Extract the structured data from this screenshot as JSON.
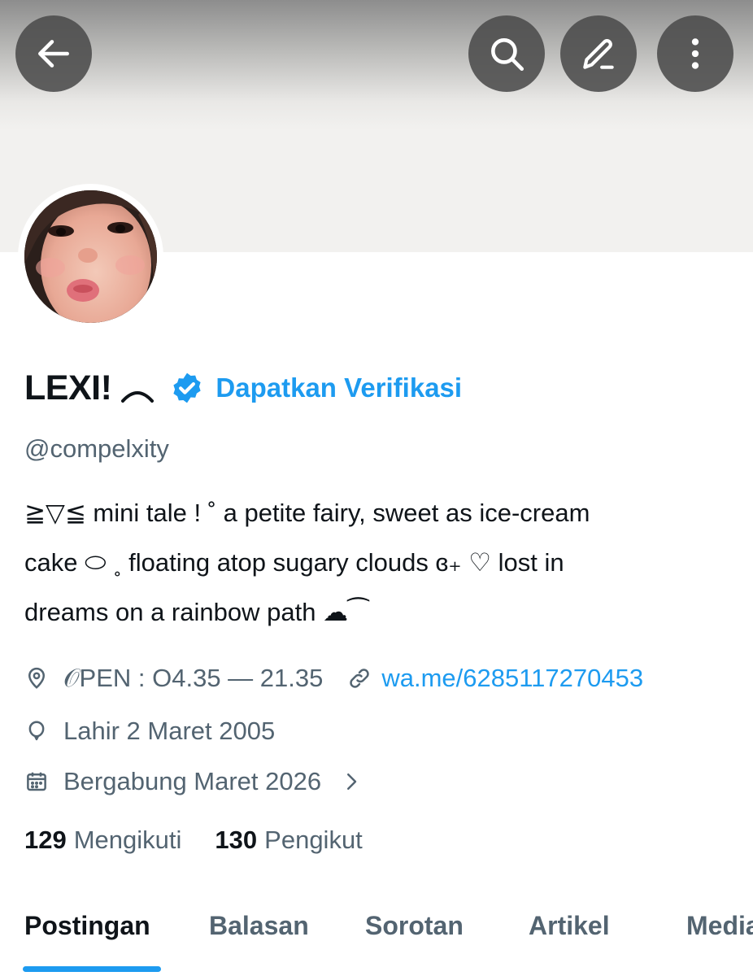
{
  "header": {
    "back": "back-arrow-icon",
    "search": "search-icon",
    "edit": "edit-pencil-icon",
    "more": "more-vertical-icon"
  },
  "profile": {
    "display_name": "LEXI!",
    "verify_label": "Dapatkan Verifikasi",
    "handle": "@compelxity",
    "bio_lines": [
      "≧▽≦  mini tale ! ˚  a petite fairy, sweet as ice-cream",
      "cake ⬭ ˳ floating atop sugary clouds ɞ₊ ♡  lost in",
      "dreams on a rainbow path ☁︎⁀"
    ],
    "location": "𝒪PEN : O4.35 — 21.35",
    "website": "wa.me/6285117270453",
    "birthday": "Lahir 2 Maret 2005",
    "joined": "Bergabung Maret 2026"
  },
  "stats": {
    "following_count": "129",
    "following_label": "Mengikuti",
    "followers_count": "130",
    "followers_label": "Pengikut"
  },
  "tabs": [
    "Postingan",
    "Balasan",
    "Sorotan",
    "Artikel",
    "Media"
  ],
  "colors": {
    "accent": "#1d9bf0",
    "text": "#0f1419",
    "secondary": "#536471"
  }
}
